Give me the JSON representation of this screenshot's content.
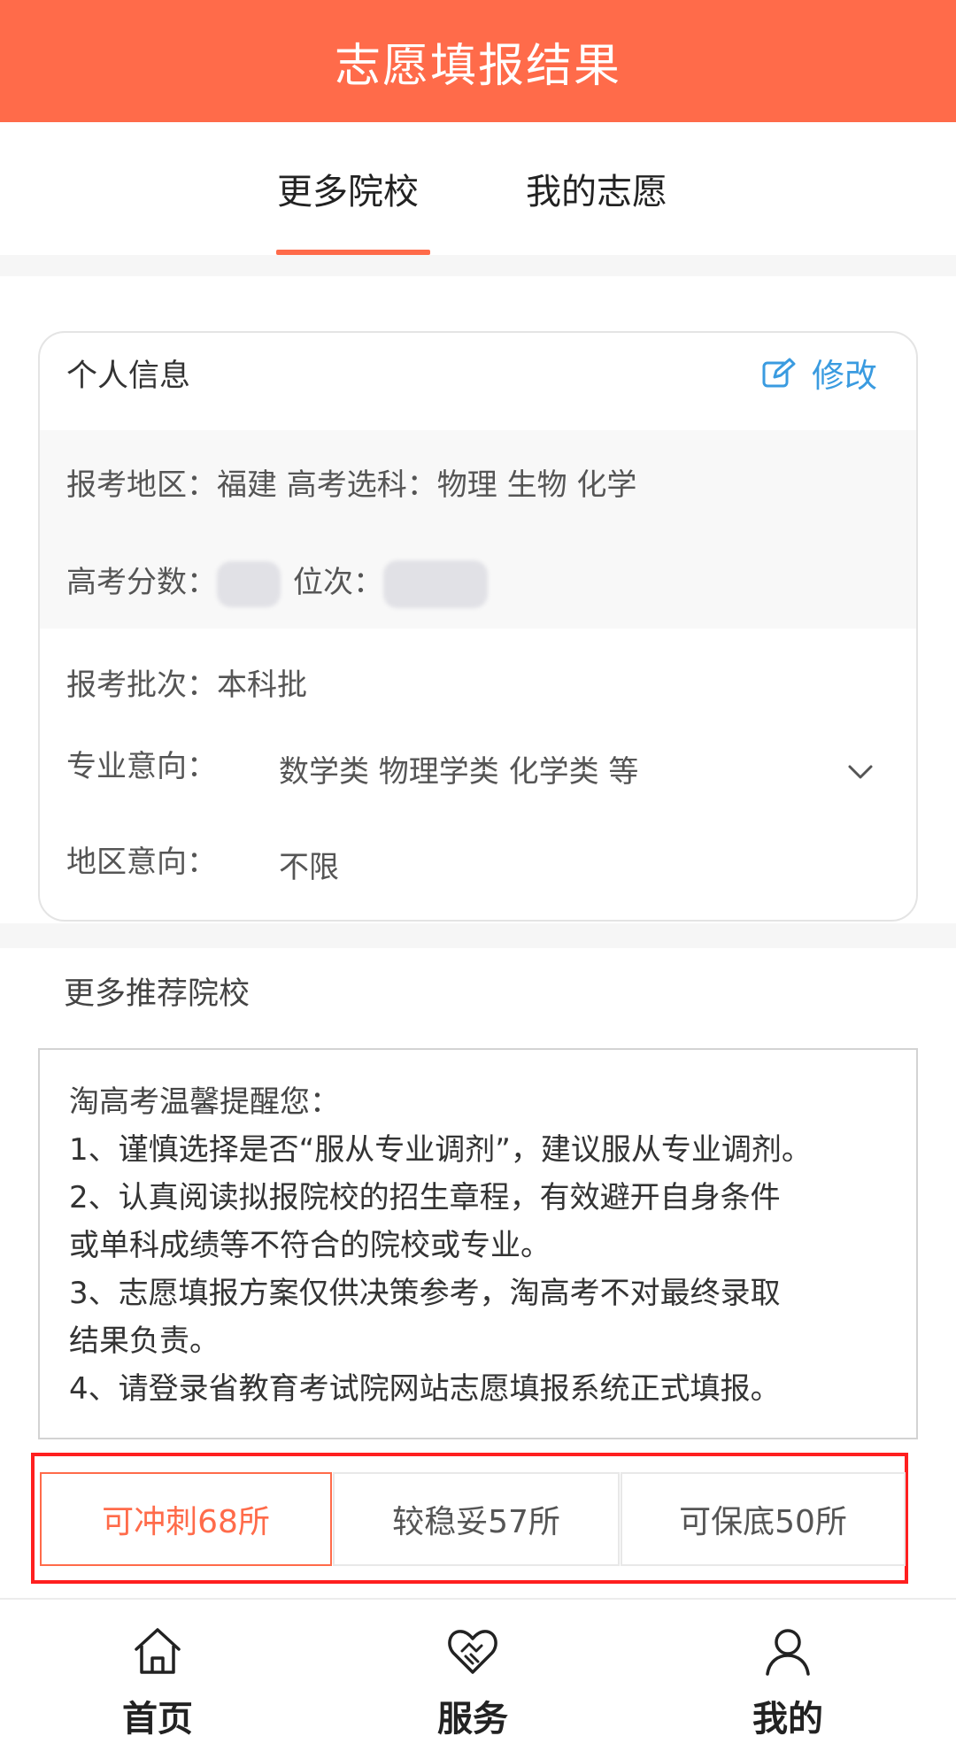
{
  "header": {
    "title": "志愿填报结果"
  },
  "tabs": [
    {
      "label": "更多院校",
      "active": true
    },
    {
      "label": "我的志愿",
      "active": false
    }
  ],
  "info": {
    "title": "个人信息",
    "edit_label": "修改",
    "region_line": "报考地区：福建  高考选科：物理 生物 化学",
    "score_label": "高考分数：",
    "rank_label": "位次：",
    "batch_line": "报考批次：本科批",
    "major_label": "专业意向：",
    "major_value": "数学类  物理学类  化学类   等",
    "area_label": "地区意向：",
    "area_value": "不限"
  },
  "section": {
    "title": "更多推荐院校"
  },
  "notice": {
    "title": "淘高考温馨提醒您：",
    "lines": [
      "1、谨慎选择是否“服从专业调剂”，建议服从专业调剂。",
      "2、认真阅读拟报院校的招生章程，有效避开自身条件",
      "或单科成绩等不符合的院校或专业。",
      "3、志愿填报方案仅供决策参考，淘高考不对最终录取",
      "结果负责。",
      "4、请登录省教育考试院网站志愿填报系统正式填报。"
    ]
  },
  "filters": [
    {
      "label": "可冲刺68所",
      "active": true
    },
    {
      "label": "较稳妥57所",
      "active": false
    },
    {
      "label": "可保底50所",
      "active": false
    }
  ],
  "nav": [
    {
      "label": "首页",
      "icon": "home-icon"
    },
    {
      "label": "服务",
      "icon": "handshake-heart-icon"
    },
    {
      "label": "我的",
      "icon": "user-icon"
    }
  ],
  "colors": {
    "brand": "#ff6b4a",
    "link": "#3a9be0",
    "highlight_frame": "#ff1f1f"
  }
}
